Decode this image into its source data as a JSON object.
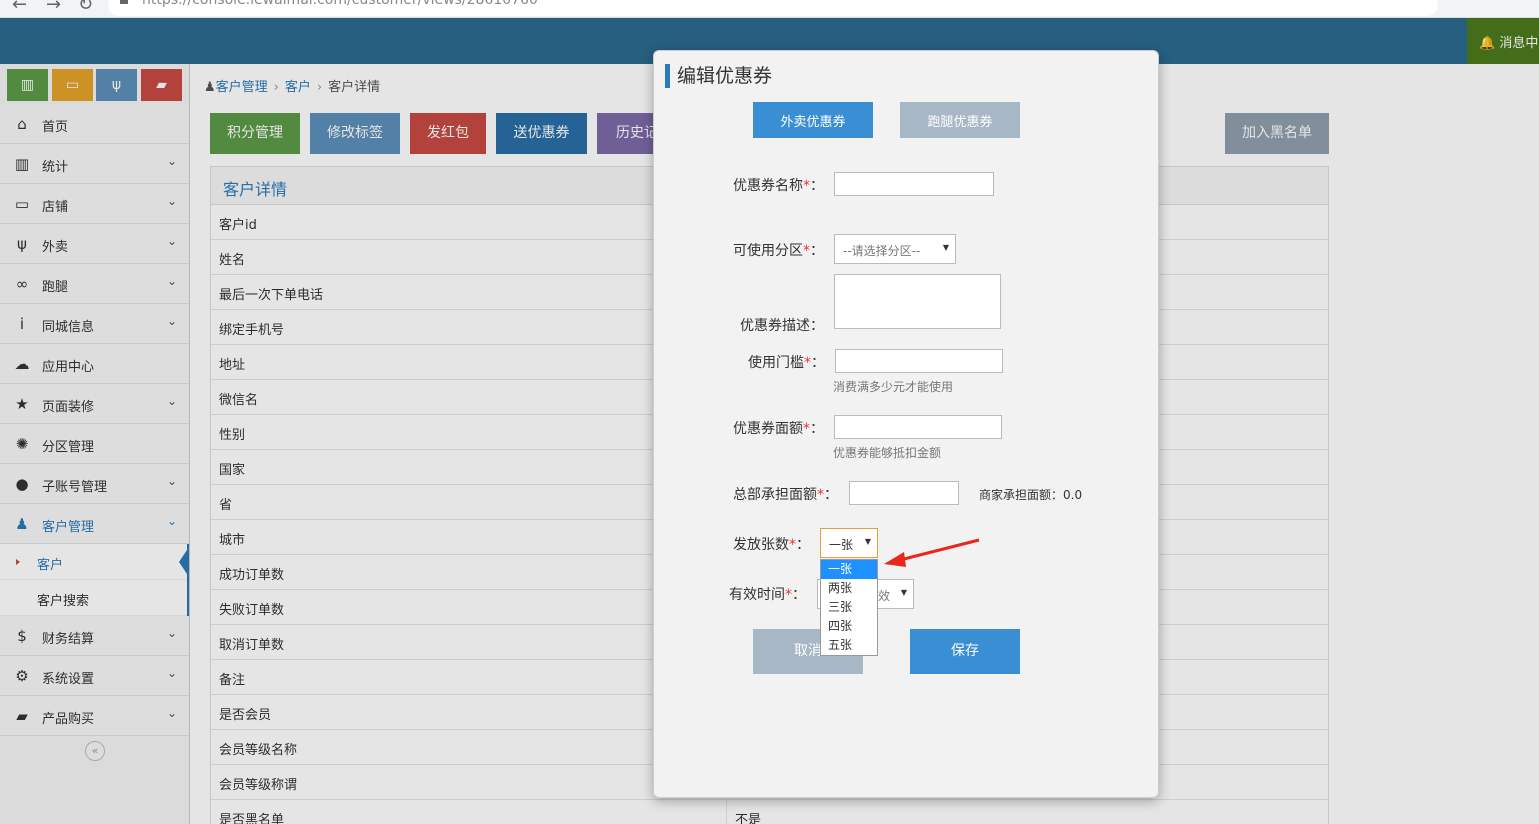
{
  "browser": {
    "url": "https://console.lewaimai.com/customer/views/28610760"
  },
  "header": {
    "message_center": "消息中"
  },
  "sidebar": {
    "shortcuts": [
      {
        "icon": "bar-chart-icon",
        "color": "#5c9a47"
      },
      {
        "icon": "monitor-icon",
        "color": "#e5a32b"
      },
      {
        "icon": "fork-knife-icon",
        "color": "#5c8fba"
      },
      {
        "icon": "bag-icon",
        "color": "#c94a43"
      }
    ],
    "menu": [
      {
        "label": "首页",
        "icon": "home-icon",
        "glyph": "⌂",
        "arrow": false
      },
      {
        "label": "统计",
        "icon": "stats-icon",
        "glyph": "▥",
        "arrow": true
      },
      {
        "label": "店铺",
        "icon": "monitor-icon",
        "glyph": "▭",
        "arrow": true
      },
      {
        "label": "外卖",
        "icon": "fork-knife-icon",
        "glyph": "ψ",
        "arrow": true
      },
      {
        "label": "跑腿",
        "icon": "bicycle-icon",
        "glyph": "∞",
        "arrow": true
      },
      {
        "label": "同城信息",
        "icon": "info-icon",
        "glyph": "i",
        "arrow": true
      },
      {
        "label": "应用中心",
        "icon": "cloud-icon",
        "glyph": "☁",
        "arrow": false
      },
      {
        "label": "页面装修",
        "icon": "star-icon",
        "glyph": "★",
        "arrow": true
      },
      {
        "label": "分区管理",
        "icon": "cog-icon",
        "glyph": "✺",
        "arrow": false
      },
      {
        "label": "子账号管理",
        "icon": "user-icon",
        "glyph": "●",
        "arrow": true
      },
      {
        "label": "客户管理",
        "icon": "users-icon",
        "glyph": "♟",
        "arrow": true,
        "active": true
      }
    ],
    "submenu": [
      {
        "label": "客户",
        "current": true
      },
      {
        "label": "客户搜索",
        "current": false
      }
    ],
    "menu_after": [
      {
        "label": "财务结算",
        "icon": "dollar-icon",
        "glyph": "$",
        "arrow": true
      },
      {
        "label": "系统设置",
        "icon": "gear-icon",
        "glyph": "⚙",
        "arrow": true
      },
      {
        "label": "产品购买",
        "icon": "briefcase-icon",
        "glyph": "▰",
        "arrow": true
      }
    ]
  },
  "breadcrumb": {
    "items": [
      "客户管理",
      "客户"
    ],
    "current": "客户详情"
  },
  "actions": [
    {
      "label": "积分管理",
      "color": "#5c9a47"
    },
    {
      "label": "修改标签",
      "color": "#5c8fba"
    },
    {
      "label": "发红包",
      "color": "#c94a43"
    },
    {
      "label": "送优惠券",
      "color": "#2a6fa8"
    },
    {
      "label": "历史记",
      "color": "#7d6aa8"
    }
  ],
  "blacklist_button": "加入黑名单",
  "panel": {
    "title": "客户详情",
    "rows": [
      {
        "key": "客户id",
        "value": ""
      },
      {
        "key": "姓名",
        "value": ""
      },
      {
        "key": "最后一次下单电话",
        "value": ""
      },
      {
        "key": "绑定手机号",
        "value": ""
      },
      {
        "key": "地址",
        "value": ""
      },
      {
        "key": "微信名",
        "value": ""
      },
      {
        "key": "性别",
        "value": ""
      },
      {
        "key": "国家",
        "value": ""
      },
      {
        "key": "省",
        "value": ""
      },
      {
        "key": "城市",
        "value": ""
      },
      {
        "key": "成功订单数",
        "value": ""
      },
      {
        "key": "失败订单数",
        "value": ""
      },
      {
        "key": "取消订单数",
        "value": ""
      },
      {
        "key": "备注",
        "value": ""
      },
      {
        "key": "是否会员",
        "value": ""
      },
      {
        "key": "会员等级名称",
        "value": ""
      },
      {
        "key": "会员等级称谓",
        "value": ""
      },
      {
        "key": "是否黑名单",
        "value": "不是"
      }
    ]
  },
  "modal": {
    "title": "编辑优惠券",
    "tabs": [
      {
        "label": "外卖优惠券",
        "color": "#3a8fd4"
      },
      {
        "label": "跑腿优惠券",
        "color": "#a7b7c6"
      }
    ],
    "fields": {
      "name_label": "优惠券名称",
      "zone_label": "可使用分区",
      "zone_placeholder": "--请选择分区--",
      "desc_label": "优惠券描述：",
      "threshold_label": "使用门槛",
      "threshold_help": "消费满多少元才能使用",
      "amount_label": "优惠券面额",
      "amount_help": "优惠券能够抵扣金额",
      "hq_label": "总部承担面额",
      "merchant_text": "商家承担面额：0.0",
      "count_label": "发放张数",
      "count_value": "一张",
      "count_options": [
        "一张",
        "两张",
        "三张",
        "四张",
        "五张"
      ],
      "valid_label": "有效时间",
      "valid_value": "效",
      "required_mark": "*",
      "colon": "："
    },
    "cancel": "取消",
    "save": "保存"
  },
  "colors": {
    "header": "#2b6a8e",
    "accent": "#2a7ab8",
    "annotation_arrow": "#e8281d"
  }
}
